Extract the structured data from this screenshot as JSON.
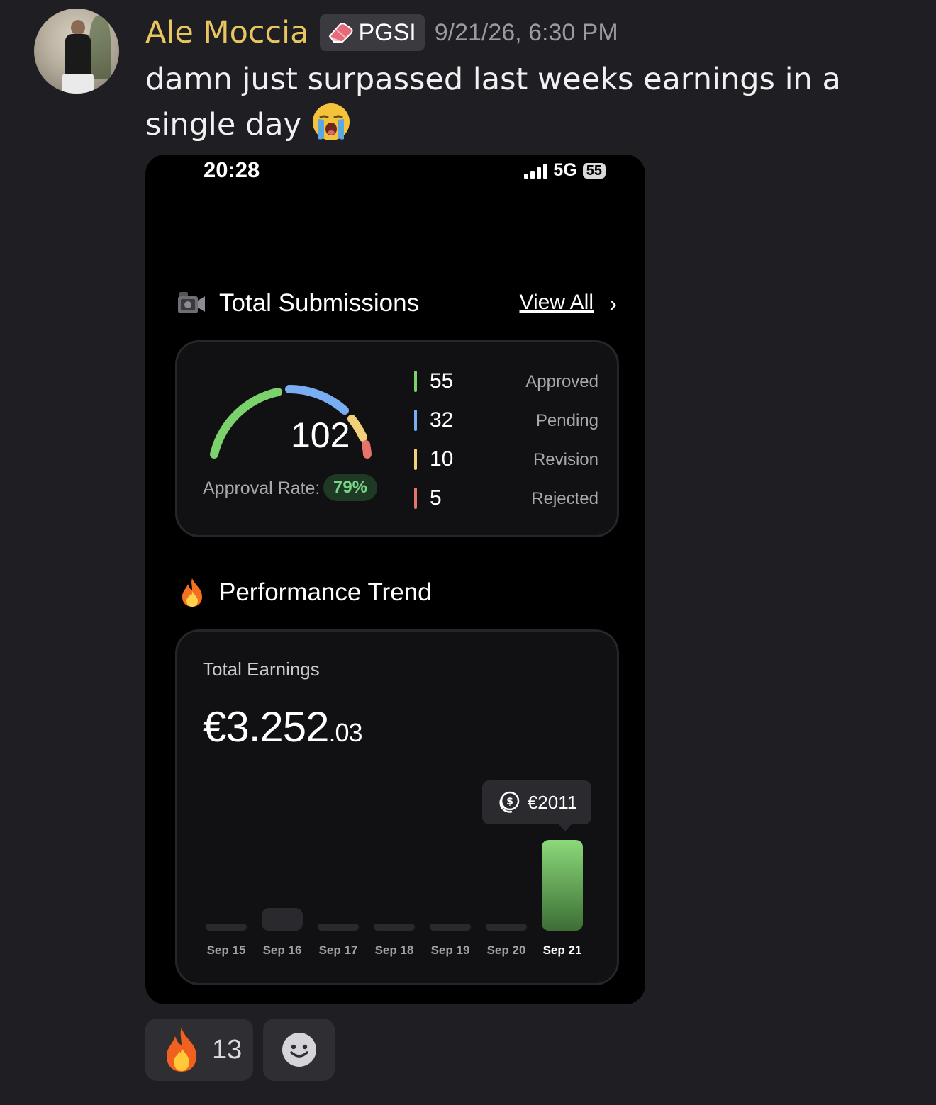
{
  "message": {
    "username": "Ale Moccia",
    "role_tag": "PGSI",
    "timestamp": "9/21/26, 6:30 PM",
    "text": "damn just surpassed last weeks earnings in a single day"
  },
  "screenshot": {
    "status_bar": {
      "time": "20:28",
      "network": "5G",
      "battery": "55"
    },
    "submissions": {
      "title": "Total Submissions",
      "view_all": "View All",
      "total": "102",
      "approval_rate_label": "Approval Rate:",
      "approval_rate": "79%",
      "stats": [
        {
          "count": "55",
          "label": "Approved",
          "color": "#7bd16b"
        },
        {
          "count": "32",
          "label": "Pending",
          "color": "#7aaef2"
        },
        {
          "count": "10",
          "label": "Revision",
          "color": "#f2d07a"
        },
        {
          "count": "5",
          "label": "Rejected",
          "color": "#e8736a"
        }
      ]
    },
    "performance": {
      "title": "Performance Trend",
      "earnings_label": "Total Earnings",
      "earnings_main": "€3.252",
      "earnings_cents": ".03",
      "tooltip": "€2011"
    }
  },
  "chart_data": {
    "type": "bar",
    "categories": [
      "Sep 15",
      "Sep 16",
      "Sep 17",
      "Sep 18",
      "Sep 19",
      "Sep 20",
      "Sep 21"
    ],
    "values": [
      0,
      500,
      0,
      0,
      0,
      0,
      2011
    ],
    "selected": "Sep 21",
    "accent": "#7bd16b"
  },
  "reactions": [
    {
      "emoji": "fire-icon",
      "count": "13"
    },
    {
      "emoji": "add-reaction-icon",
      "count": ""
    }
  ]
}
